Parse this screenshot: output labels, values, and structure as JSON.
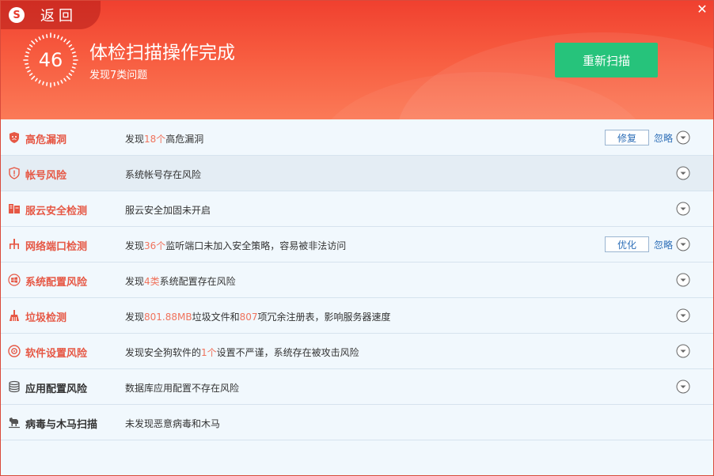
{
  "header": {
    "back_label": "返回",
    "logo_letter": "S",
    "close_glyph": "✕",
    "score": "46",
    "title": "体检扫描操作完成",
    "subtitle": "发现7类问题",
    "rescan_label": "重新扫描"
  },
  "colors": {
    "header_red": "#f0402f",
    "rescan_green": "#26c37b",
    "issue_red": "#e65845",
    "link_blue": "#2d6eb7"
  },
  "rows": [
    {
      "icon": "shield-icon",
      "title": "高危漏洞",
      "desc_pre": "发现",
      "desc_num": "18个",
      "desc_post": "高危漏洞",
      "action": "修复",
      "ignore": "忽略"
    },
    {
      "icon": "account-shield-icon",
      "title": "帐号风险",
      "desc": "系统帐号存在风险"
    },
    {
      "icon": "server-icon",
      "title": "服云安全检测",
      "desc": "服云安全加固未开启"
    },
    {
      "icon": "network-icon",
      "title": "网络端口检测",
      "desc_pre": "发现",
      "desc_num": "36个",
      "desc_post": "监听端口未加入安全策略，容易被非法访问",
      "action": "优化",
      "ignore": "忽略"
    },
    {
      "icon": "windows-icon",
      "title": "系统配置风险",
      "desc_pre": "发现",
      "desc_num": "4类",
      "desc_post": "系统配置存在风险"
    },
    {
      "icon": "broom-icon",
      "title": "垃圾检测",
      "desc_pre": "发现",
      "desc_num": "801.88MB",
      "desc_mid": "垃圾文件和",
      "desc_num2": "807",
      "desc_post": "项冗余注册表，影响服务器速度"
    },
    {
      "icon": "software-icon",
      "title": "软件设置风险",
      "desc_pre": "发现安全狗软件的",
      "desc_num": "1个",
      "desc_post": "设置不严谨，系统存在被攻击风险"
    },
    {
      "icon": "database-icon",
      "title": "应用配置风险",
      "desc": "数据库应用配置不存在风险"
    },
    {
      "icon": "trojan-horse-icon",
      "title": "病毒与木马扫描",
      "desc": "未发现恶意病毒和木马"
    }
  ]
}
